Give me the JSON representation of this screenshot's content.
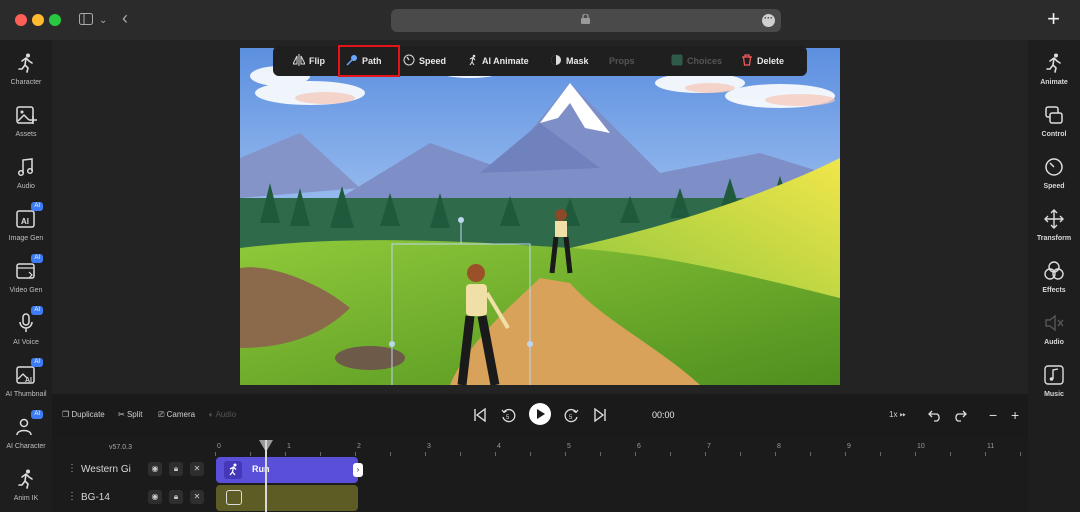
{
  "toolbar": {
    "flip": "Flip",
    "path": "Path",
    "speed": "Speed",
    "ai_animate": "AI Animate",
    "mask": "Mask",
    "props": "Props",
    "choices": "Choices",
    "delete": "Delete"
  },
  "left_sidebar": [
    {
      "label": "Character",
      "icon": "run-icon"
    },
    {
      "label": "Assets",
      "icon": "image-plus-icon"
    },
    {
      "label": "Audio",
      "icon": "music-icon"
    },
    {
      "label": "Image Gen",
      "icon": "image-ai-icon",
      "badge": "AI"
    },
    {
      "label": "Video Gen",
      "icon": "video-ai-icon",
      "badge": "AI"
    },
    {
      "label": "AI Voice",
      "icon": "mic-icon",
      "badge": "AI"
    },
    {
      "label": "AI Thumbnail",
      "icon": "thumbnail-icon",
      "badge": "AI"
    },
    {
      "label": "AI Character",
      "icon": "person-ai-icon",
      "badge": "AI"
    },
    {
      "label": "Anim IK",
      "icon": "run-ik-icon"
    }
  ],
  "right_sidebar": [
    {
      "label": "Animate",
      "icon": "run-icon"
    },
    {
      "label": "Control",
      "icon": "control-icon"
    },
    {
      "label": "Speed",
      "icon": "speed-icon"
    },
    {
      "label": "Transform",
      "icon": "move-icon"
    },
    {
      "label": "Effects",
      "icon": "effects-icon"
    },
    {
      "label": "Audio",
      "icon": "volume-icon"
    },
    {
      "label": "Music",
      "icon": "music-note-icon"
    }
  ],
  "controls": {
    "duplicate": "Duplicate",
    "split": "Split",
    "camera": "Camera",
    "audio": "Audio",
    "time": "00:00",
    "speed": "1x"
  },
  "timeline": {
    "version": "v57.0.3",
    "ticks": [
      "0",
      "1",
      "2",
      "3",
      "4",
      "5",
      "6",
      "7",
      "8",
      "9",
      "10",
      "11"
    ],
    "tracks": [
      {
        "name": "Western Gi",
        "clip_label": "Run"
      },
      {
        "name": "BG-14",
        "clip_label": ""
      }
    ]
  },
  "colors": {
    "accent": "#5a4fd9",
    "highlight": "#e5141a",
    "ai_badge": "#3d7bf7"
  }
}
